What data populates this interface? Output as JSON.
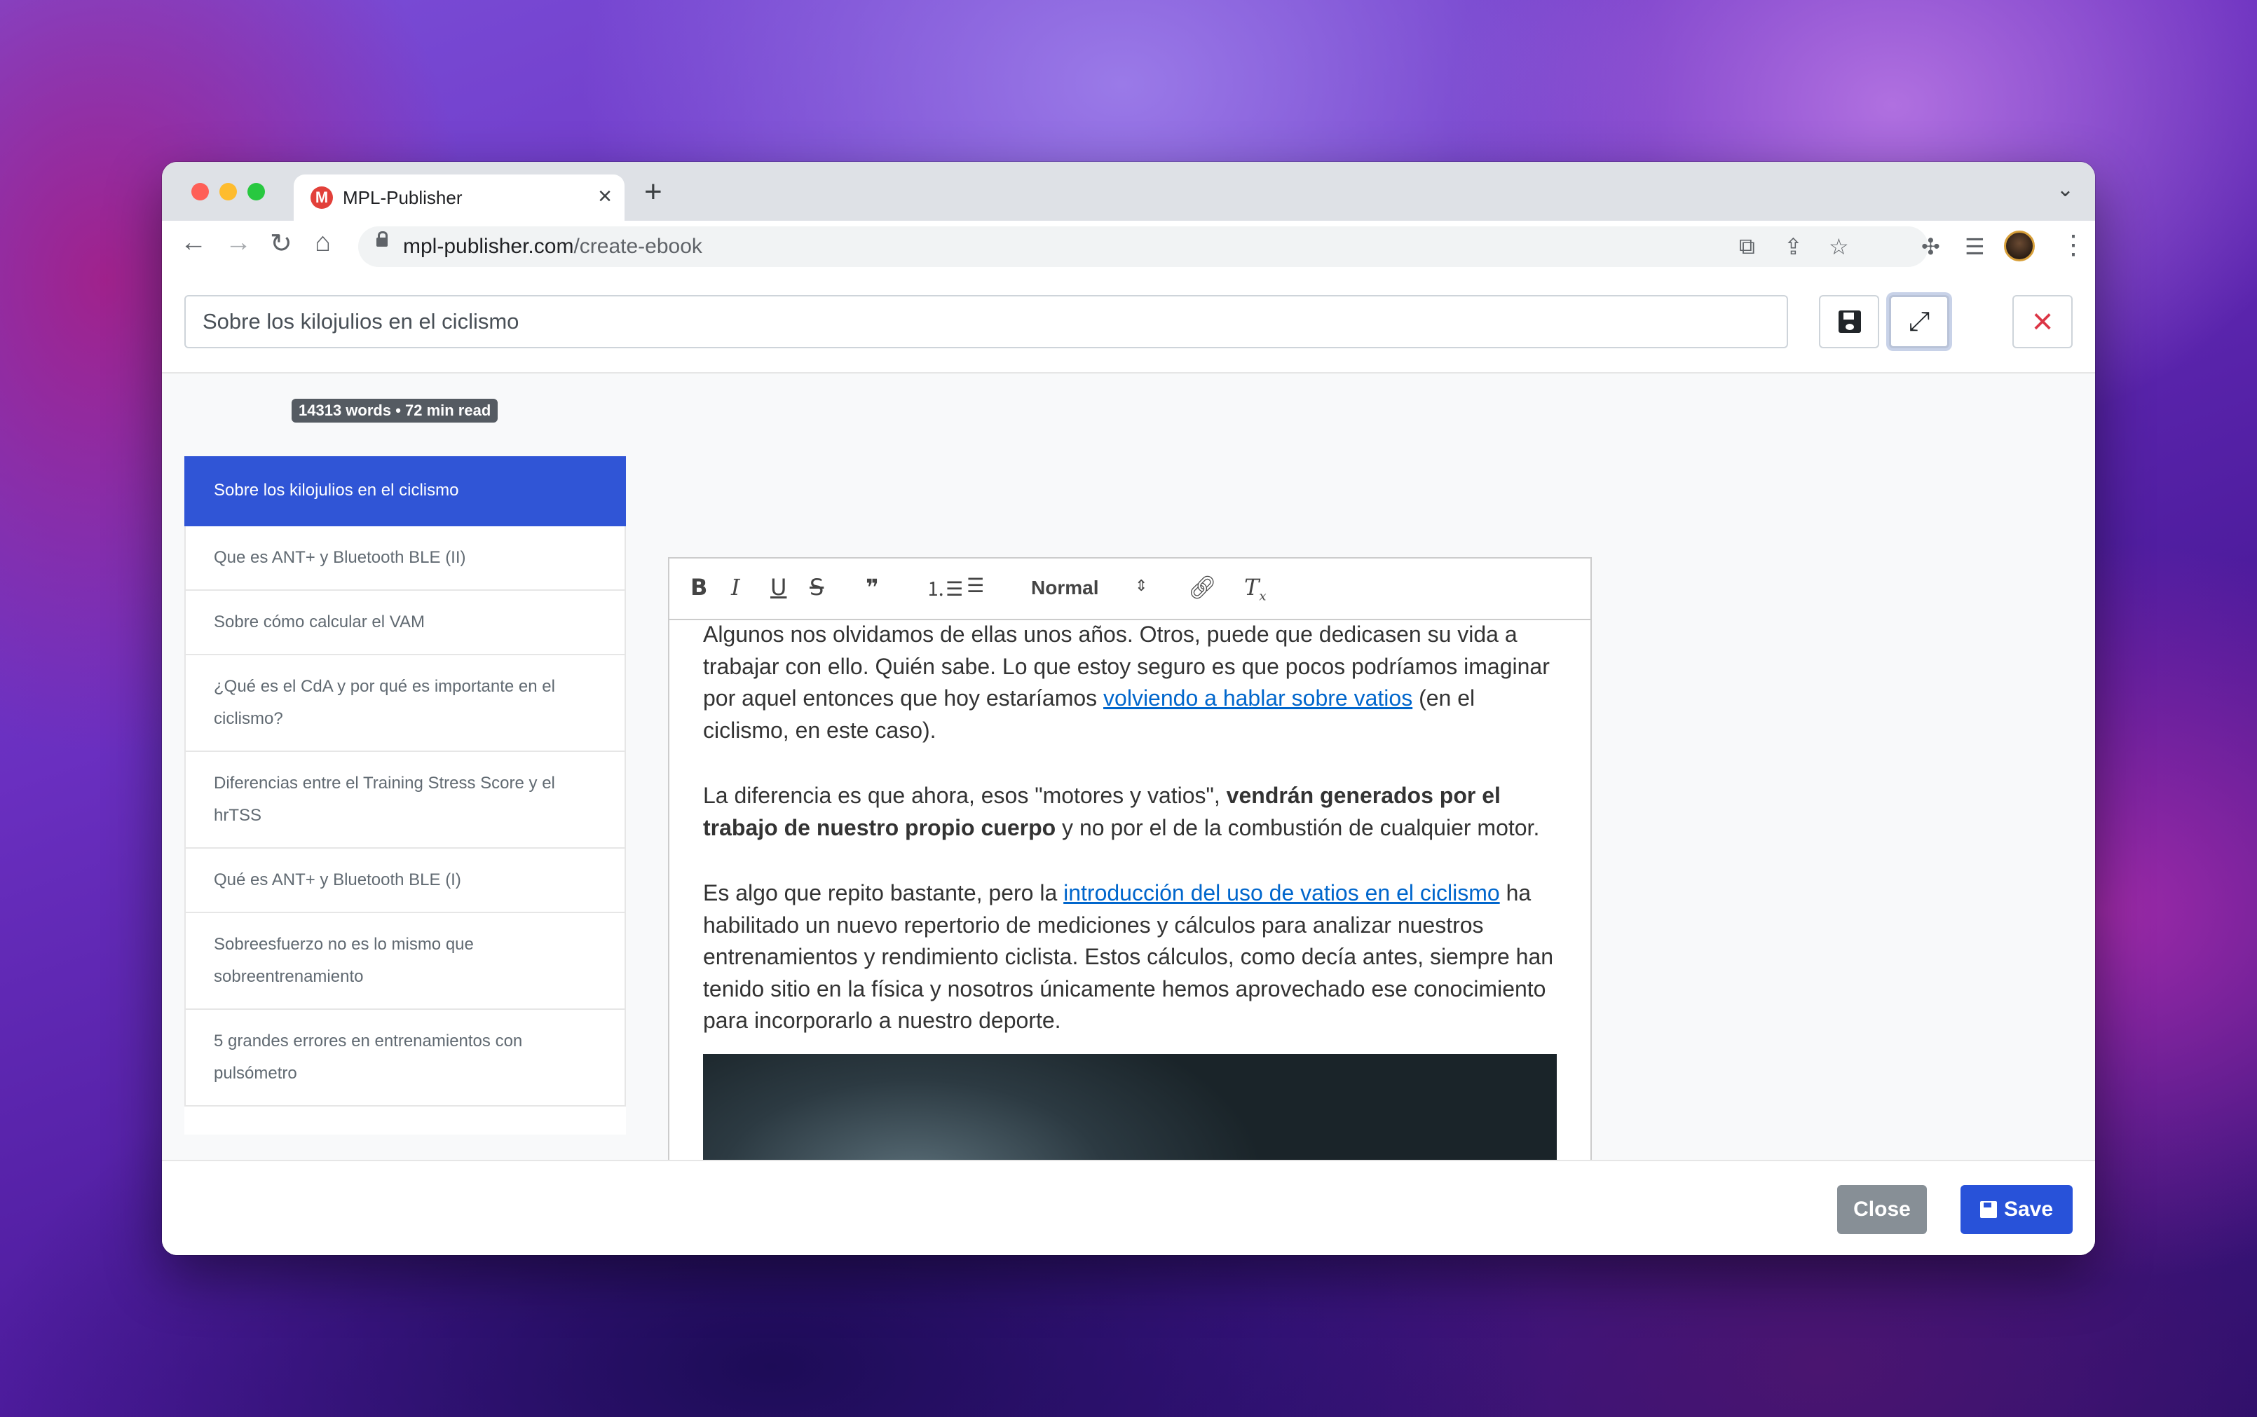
{
  "browser": {
    "tab_title": "MPL-Publisher",
    "tab_favicon_letter": "M",
    "url_domain": "mpl-publisher.com",
    "url_path": "/create-ebook"
  },
  "editor_header": {
    "title_value": "Sobre los kilojulios en el ciclismo"
  },
  "stats_badge": "14313 words • 72 min read",
  "chapters": [
    "Sobre los kilojulios en el ciclismo",
    "Que es ANT+ y Bluetooth BLE (II)",
    "Sobre cómo calcular el VAM",
    "¿Qué es el CdA y por qué es importante en el ciclismo?",
    "Diferencias entre el Training Stress Score y el hrTSS",
    "Qué es ANT+ y Bluetooth BLE (I)",
    "Sobreesfuerzo no es lo mismo que sobreentrenamiento",
    "5 grandes errores en entrenamientos con pulsómetro"
  ],
  "toolbar": {
    "bold": "B",
    "italic": "I",
    "underline": "U",
    "strike": "S",
    "quote": "❞",
    "format_select": "Normal"
  },
  "content": {
    "p1_a": "Algunos nos olvidamos de ellas unos años. Otros, puede que dedicasen su vida a trabajar con ello. Quién sabe. Lo que estoy seguro es que pocos podríamos imaginar por aquel entonces que hoy estaríamos ",
    "p1_link": "volviendo a hablar sobre vatios",
    "p1_b": " (en el ciclismo, en este caso).",
    "p2_a": "La diferencia es que ahora, esos \"motores y vatios\", ",
    "p2_bold": "vendrán generados por el trabajo de nuestro propio cuerpo",
    "p2_b": " y no por el de la combustión de cualquier motor.",
    "p3_a": "Es algo que repito bastante, pero la ",
    "p3_link": "introducción del uso de vatios en el ciclismo",
    "p3_b": " ha habilitado un nuevo repertorio de mediciones y cálculos para analizar nuestros entrenamientos y rendimiento ciclista. Estos cálculos, como decía antes, siempre han tenido sitio en la física y nosotros únicamente hemos aprovechado ese conocimiento para incorporarlo a nuestro deporte."
  },
  "footer": {
    "close_label": "Close",
    "save_label": "Save"
  },
  "colors": {
    "active_chapter": "#3055d6",
    "save_button": "#2852d9",
    "close_button": "#878f96",
    "link": "#0066cc",
    "delete": "#dc3545"
  }
}
